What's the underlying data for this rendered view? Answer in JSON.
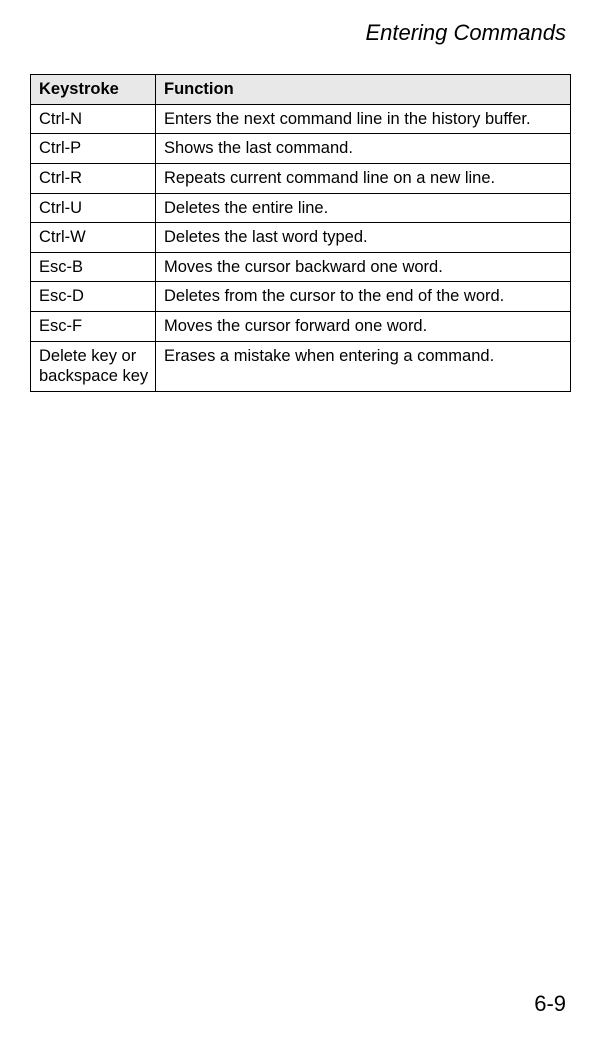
{
  "page_title": "Entering Commands",
  "page_number": "6-9",
  "table": {
    "headers": {
      "keystroke": "Keystroke",
      "function": "Function"
    },
    "rows": [
      {
        "keystroke": "Ctrl-N",
        "function": "Enters the next command line in the history buffer."
      },
      {
        "keystroke": "Ctrl-P",
        "function": "Shows the last command."
      },
      {
        "keystroke": "Ctrl-R",
        "function": "Repeats current command line on a new line."
      },
      {
        "keystroke": "Ctrl-U",
        "function": "Deletes the entire line."
      },
      {
        "keystroke": "Ctrl-W",
        "function": "Deletes the last word typed."
      },
      {
        "keystroke": "Esc-B",
        "function": "Moves the cursor backward one word."
      },
      {
        "keystroke": "Esc-D",
        "function": "Deletes from the cursor to the end of the word."
      },
      {
        "keystroke": "Esc-F",
        "function": "Moves the cursor forward one word."
      },
      {
        "keystroke": "Delete key or backspace key",
        "function": "Erases a mistake when entering a command."
      }
    ]
  }
}
